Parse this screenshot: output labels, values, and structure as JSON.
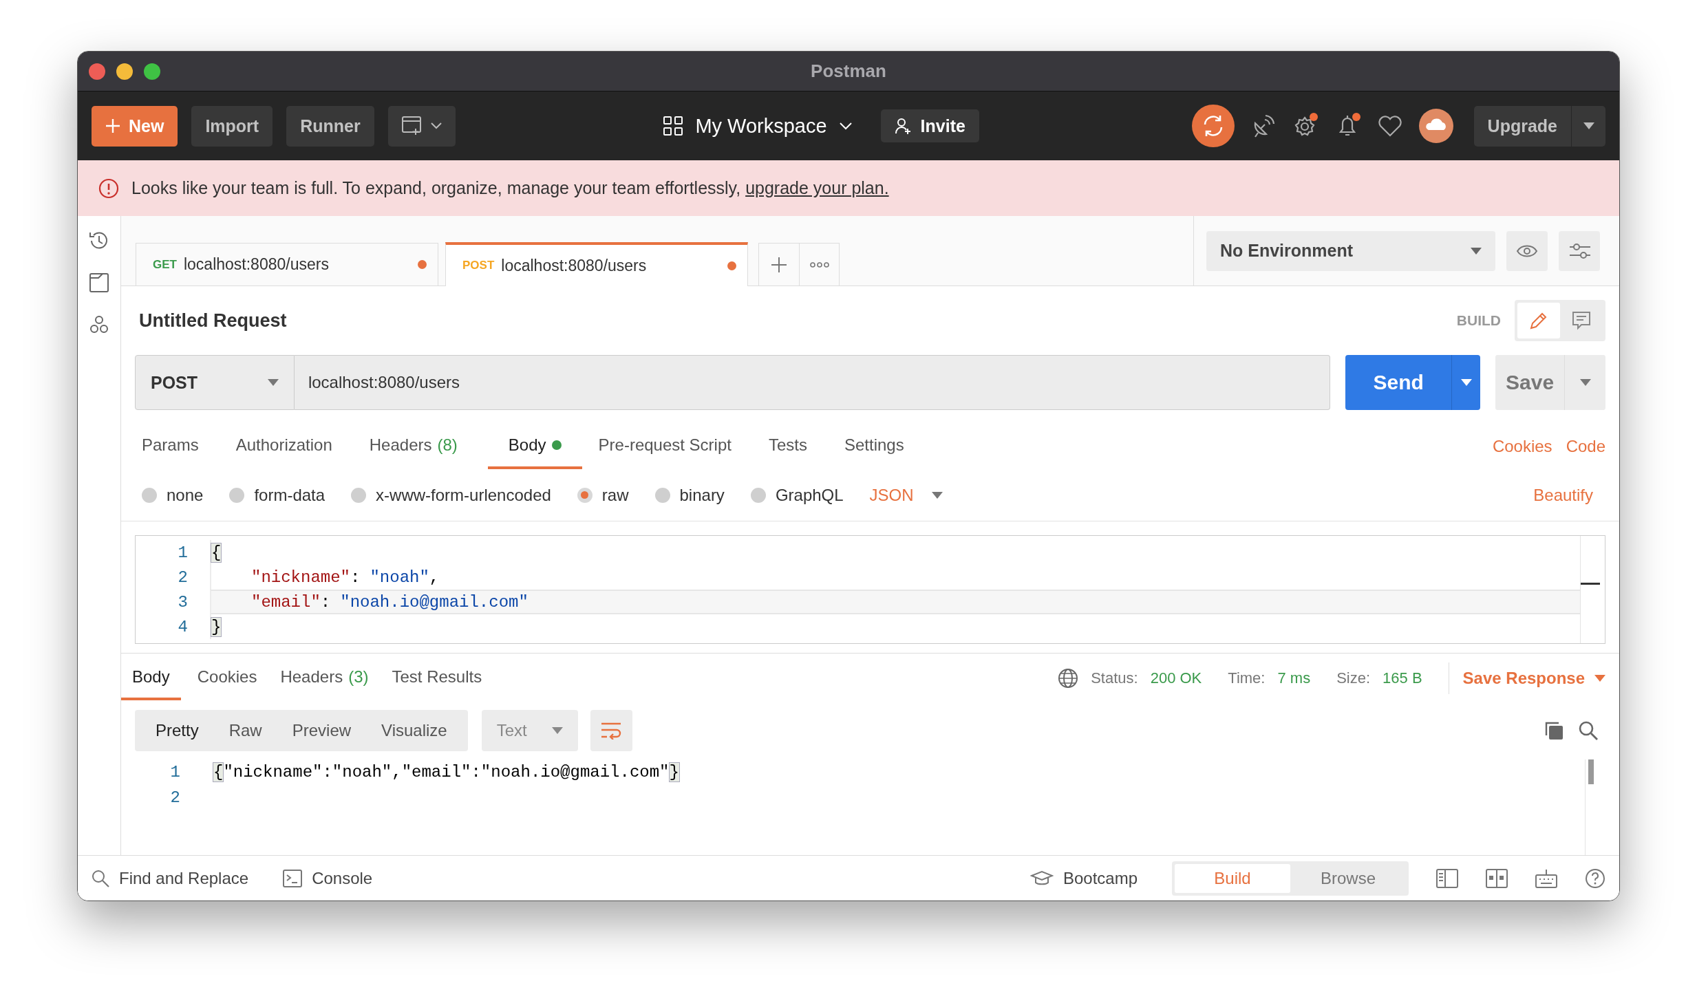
{
  "window": {
    "title": "Postman"
  },
  "toolbar": {
    "new_button": "New",
    "import_button": "Import",
    "runner_button": "Runner",
    "workspace": "My Workspace",
    "invite_button": "Invite",
    "icons": [
      {
        "kind": "sync",
        "badge": false
      },
      {
        "kind": "satellite",
        "badge": false
      },
      {
        "kind": "settings",
        "badge": true
      },
      {
        "kind": "bell",
        "badge": true
      },
      {
        "kind": "heart",
        "badge": false
      },
      {
        "kind": "avatar",
        "badge": false
      }
    ],
    "upgrade_button": "Upgrade"
  },
  "banner": {
    "message": "Looks like your team is full. To expand, organize, manage your team effortlessly,",
    "link": "upgrade your plan."
  },
  "request_tabs": [
    {
      "method": "GET",
      "color": "#3a9a4b",
      "url": "localhost:8080/users",
      "unsaved": true,
      "selected": false
    },
    {
      "method": "POST",
      "color": "#f5a623",
      "url": "localhost:8080/users",
      "unsaved": true,
      "selected": true
    }
  ],
  "environment": {
    "value": "No Environment"
  },
  "request": {
    "name": "Untitled Request",
    "mode_label": "BUILD",
    "method": "POST",
    "url": "localhost:8080/users",
    "send_button": "Send",
    "save_button": "Save"
  },
  "request_sections": [
    {
      "label": "Params",
      "selected": false,
      "has_content": false
    },
    {
      "label": "Authorization",
      "selected": false,
      "has_content": false
    },
    {
      "label": "Headers",
      "count": "(8)",
      "selected": false,
      "has_content": false
    },
    {
      "label": "Body",
      "selected": true,
      "has_content": true
    },
    {
      "label": "Pre-request Script",
      "selected": false,
      "has_content": false
    },
    {
      "label": "Tests",
      "selected": false,
      "has_content": false
    },
    {
      "label": "Settings",
      "selected": false,
      "has_content": false
    }
  ],
  "request_links": [
    "Cookies",
    "Code"
  ],
  "body_types": [
    {
      "label": "none",
      "selected": false
    },
    {
      "label": "form-data",
      "selected": false
    },
    {
      "label": "x-www-form-urlencoded",
      "selected": false
    },
    {
      "label": "raw",
      "selected": true
    },
    {
      "label": "binary",
      "selected": false
    },
    {
      "label": "GraphQL",
      "selected": false
    }
  ],
  "body_format": "JSON",
  "beautify_link": "Beautify",
  "editor": {
    "lines": [
      {
        "number": "1",
        "indented": false,
        "active": false,
        "tokens": [
          {
            "kind": "punct",
            "text": "{",
            "matched": true
          }
        ]
      },
      {
        "number": "2",
        "indented": true,
        "active": false,
        "tokens": [
          {
            "kind": "key",
            "text": "\"nickname\"",
            "matched": false
          },
          {
            "kind": "punct",
            "text": ":",
            "matched": false
          },
          {
            "kind": "string",
            "text": "\"noah\"",
            "matched": false
          },
          {
            "kind": "punct",
            "text": ",",
            "matched": false
          }
        ]
      },
      {
        "number": "3",
        "indented": true,
        "active": true,
        "tokens": [
          {
            "kind": "key",
            "text": "\"email\"",
            "matched": false
          },
          {
            "kind": "punct",
            "text": ":",
            "matched": false
          },
          {
            "kind": "string",
            "text": "\"noah.io@gmail.com\"",
            "matched": false
          }
        ]
      },
      {
        "number": "4",
        "indented": false,
        "active": false,
        "tokens": [
          {
            "kind": "punct",
            "text": "}",
            "matched": true
          }
        ]
      }
    ]
  },
  "response": {
    "tabs": [
      {
        "label": "Body",
        "selected": true
      },
      {
        "label": "Cookies",
        "selected": false
      },
      {
        "label": "Headers",
        "count": "(3)",
        "selected": false
      },
      {
        "label": "Test Results",
        "selected": false
      }
    ],
    "stats": [
      {
        "label": "Status:",
        "value": "200 OK"
      },
      {
        "label": "Time:",
        "value": "7 ms"
      },
      {
        "label": "Size:",
        "value": "165 B"
      }
    ],
    "save_response": "Save Response",
    "view_modes": [
      {
        "label": "Pretty",
        "selected": true
      },
      {
        "label": "Raw",
        "selected": false
      },
      {
        "label": "Preview",
        "selected": false
      },
      {
        "label": "Visualize",
        "selected": false
      }
    ],
    "format": "Text",
    "lines": [
      {
        "number": "1",
        "tokens": [
          {
            "text": "{",
            "matched": true
          },
          {
            "text": "\"nickname\":\"noah\",\"email\":\"noah.io@gmail.com\"",
            "matched": false
          },
          {
            "text": "}",
            "matched": true
          }
        ]
      },
      {
        "number": "2"
      }
    ]
  },
  "footer": {
    "find_replace": "Find and Replace",
    "console": "Console",
    "bootcamp": "Bootcamp",
    "modes": [
      {
        "label": "Build",
        "selected": true
      },
      {
        "label": "Browse",
        "selected": false
      }
    ]
  }
}
